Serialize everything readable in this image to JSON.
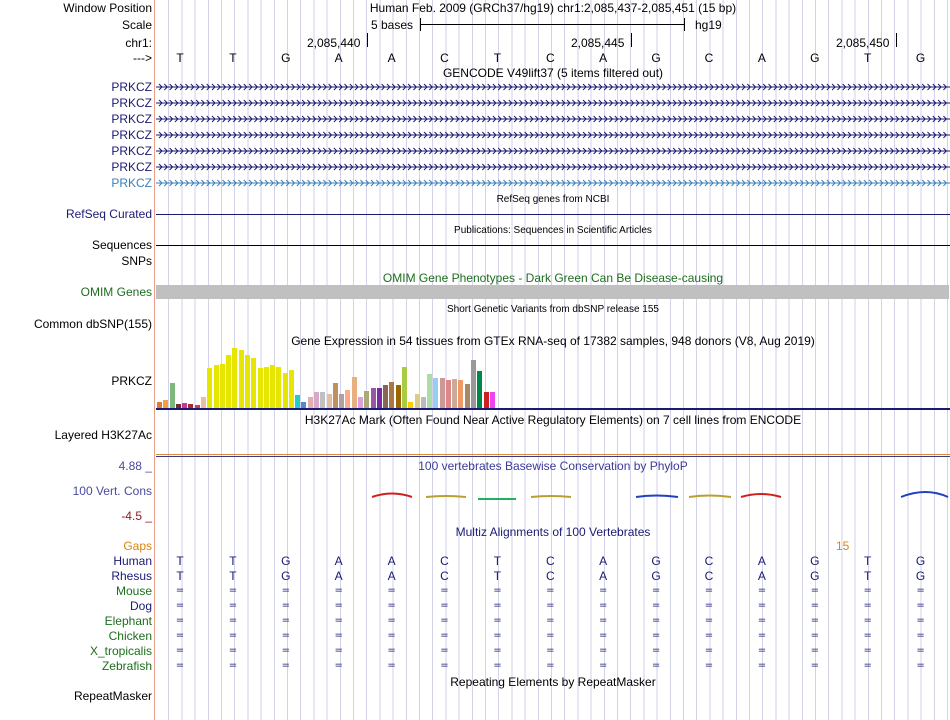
{
  "header": {
    "window_position_label": "Window Position",
    "scale_label": "Scale",
    "chrom_label": "chr1:",
    "arrow_label": "--->",
    "assembly_text": "Human Feb. 2009 (GRCh37/hg19)   chr1:2,085,437-2,085,451 (15 bp)",
    "scale_text": "5 bases",
    "db_text": "hg19",
    "positions": [
      "2,085,440",
      "2,085,445",
      "2,085,450"
    ]
  },
  "bases": [
    "T",
    "T",
    "G",
    "A",
    "A",
    "C",
    "T",
    "C",
    "A",
    "G",
    "C",
    "A",
    "G",
    "T",
    "G"
  ],
  "gencode": {
    "title": "GENCODE V49lift37 (5 items filtered out)",
    "genes": [
      "PRKCZ",
      "PRKCZ",
      "PRKCZ",
      "PRKCZ",
      "PRKCZ",
      "PRKCZ",
      "PRKCZ"
    ],
    "navy": "#1a1a73",
    "highlight": "#3a80b8"
  },
  "refseq": {
    "title": "RefSeq genes from NCBI",
    "label": "RefSeq Curated"
  },
  "publications": {
    "title": "Publications: Sequences in Scientific Articles",
    "label": "Sequences"
  },
  "snps": {
    "label": "SNPs"
  },
  "omim": {
    "title": "OMIM Gene Phenotypes - Dark Green Can Be Disease-causing",
    "label": "OMIM Genes",
    "bar_color": "#c0c0c0"
  },
  "dbsnp": {
    "title": "Short Genetic Variants from dbSNP release 155",
    "label": "Common dbSNP(155)"
  },
  "gtex": {
    "title": "Gene Expression in 54 tissues from GTEx RNA-seq of 17382 samples, 948 donors (V8, Aug 2019)",
    "label": "PRKCZ",
    "levels": [
      {
        "v": 0.1,
        "c": "#e07a30"
      },
      {
        "v": 0.14,
        "c": "#f0a040"
      },
      {
        "v": 0.42,
        "c": "#7fb87f"
      },
      {
        "v": 0.07,
        "c": "#6a3030"
      },
      {
        "v": 0.09,
        "c": "#cc3399"
      },
      {
        "v": 0.06,
        "c": "#a03030"
      },
      {
        "v": 0.05,
        "c": "#d04040"
      },
      {
        "v": 0.18,
        "c": "#e8c0a0"
      },
      {
        "v": 0.66,
        "c": "#e6e600"
      },
      {
        "v": 0.72,
        "c": "#e6e600"
      },
      {
        "v": 0.74,
        "c": "#e6e600"
      },
      {
        "v": 0.88,
        "c": "#e6e600"
      },
      {
        "v": 1.0,
        "c": "#e6e600"
      },
      {
        "v": 0.96,
        "c": "#e6e600"
      },
      {
        "v": 0.88,
        "c": "#e6e600"
      },
      {
        "v": 0.84,
        "c": "#e6e600"
      },
      {
        "v": 0.66,
        "c": "#e6e600"
      },
      {
        "v": 0.68,
        "c": "#e6e600"
      },
      {
        "v": 0.72,
        "c": "#e6e600"
      },
      {
        "v": 0.68,
        "c": "#e6e600"
      },
      {
        "v": 0.58,
        "c": "#e6e600"
      },
      {
        "v": 0.63,
        "c": "#e6e600"
      },
      {
        "v": 0.22,
        "c": "#22cccc"
      },
      {
        "v": 0.1,
        "c": "#5588cc"
      },
      {
        "v": 0.18,
        "c": "#e0b0b0"
      },
      {
        "v": 0.26,
        "c": "#d8a8c8"
      },
      {
        "v": 0.26,
        "c": "#c0c0c0"
      },
      {
        "v": 0.24,
        "c": "#e0c0a0"
      },
      {
        "v": 0.42,
        "c": "#c09060"
      },
      {
        "v": 0.24,
        "c": "#b0a0a0"
      },
      {
        "v": 0.3,
        "c": "#ffaa88"
      },
      {
        "v": 0.52,
        "c": "#e8b080"
      },
      {
        "v": 0.18,
        "c": "#dda0dd"
      },
      {
        "v": 0.28,
        "c": "#aaaa77"
      },
      {
        "v": 0.34,
        "c": "#9955aa"
      },
      {
        "v": 0.34,
        "c": "#7a2aa0"
      },
      {
        "v": 0.38,
        "c": "#886655"
      },
      {
        "v": 0.44,
        "c": "#aa7744"
      },
      {
        "v": 0.38,
        "c": "#996600"
      },
      {
        "v": 0.68,
        "c": "#aacc44"
      },
      {
        "v": 0.1,
        "c": "#ffcc00"
      },
      {
        "v": 0.24,
        "c": "#ddcc88"
      },
      {
        "v": 0.18,
        "c": "#bbbbbb"
      },
      {
        "v": 0.56,
        "c": "#aaddaa"
      },
      {
        "v": 0.5,
        "c": "#99ccee"
      },
      {
        "v": 0.5,
        "c": "#cc9999"
      },
      {
        "v": 0.46,
        "c": "#dd8888"
      },
      {
        "v": 0.48,
        "c": "#ccaa99"
      },
      {
        "v": 0.46,
        "c": "#ee9966"
      },
      {
        "v": 0.4,
        "c": "#aa8866"
      },
      {
        "v": 0.8,
        "c": "#999999"
      },
      {
        "v": 0.62,
        "c": "#00884a"
      },
      {
        "v": 0.26,
        "c": "#cc2222"
      },
      {
        "v": 0.27,
        "c": "#ee44ee"
      }
    ]
  },
  "h3k27ac": {
    "title": "H3K27Ac Mark (Often Found Near Active Regulatory Elements) on 7 cell lines from ENCODE",
    "label": "Layered H3K27Ac"
  },
  "conservation": {
    "title": "100 vertebrates Basewise Conservation by PhyloP",
    "label": "100 Vert. Cons",
    "max": "4.88 _",
    "min": "-4.5 _"
  },
  "multiz": {
    "title": "Multiz Alignments of 100 Vertebrates",
    "gaps_label": "Gaps",
    "gaps_value": "15",
    "species": [
      {
        "name": "Human",
        "seq": [
          "T",
          "T",
          "G",
          "A",
          "A",
          "C",
          "T",
          "C",
          "A",
          "G",
          "C",
          "A",
          "G",
          "T",
          "G"
        ]
      },
      {
        "name": "Rhesus",
        "seq": [
          "T",
          "T",
          "G",
          "A",
          "A",
          "C",
          "T",
          "C",
          "A",
          "G",
          "C",
          "A",
          "G",
          "T",
          "G"
        ]
      },
      {
        "name": "Mouse",
        "seq": [
          "=",
          "=",
          "=",
          "=",
          "=",
          "=",
          "=",
          "=",
          "=",
          "=",
          "=",
          "=",
          "=",
          "=",
          "="
        ]
      },
      {
        "name": "Dog",
        "seq": [
          "=",
          "=",
          "=",
          "=",
          "=",
          "=",
          "=",
          "=",
          "=",
          "=",
          "=",
          "=",
          "=",
          "=",
          "="
        ]
      },
      {
        "name": "Elephant",
        "seq": [
          "=",
          "=",
          "=",
          "=",
          "=",
          "=",
          "=",
          "=",
          "=",
          "=",
          "=",
          "=",
          "=",
          "=",
          "="
        ]
      },
      {
        "name": "Chicken",
        "seq": [
          "=",
          "=",
          "=",
          "=",
          "=",
          "=",
          "=",
          "=",
          "=",
          "=",
          "=",
          "=",
          "=",
          "=",
          "="
        ]
      },
      {
        "name": "X_tropicalis",
        "seq": [
          "=",
          "=",
          "=",
          "=",
          "=",
          "=",
          "=",
          "=",
          "=",
          "=",
          "=",
          "=",
          "=",
          "=",
          "="
        ]
      },
      {
        "name": "Zebrafish",
        "seq": [
          "=",
          "=",
          "=",
          "=",
          "=",
          "=",
          "=",
          "=",
          "=",
          "=",
          "=",
          "=",
          "=",
          "=",
          "="
        ]
      }
    ]
  },
  "repeatmasker": {
    "title": "Repeating Elements by RepeatMasker",
    "label": "RepeatMasker"
  }
}
